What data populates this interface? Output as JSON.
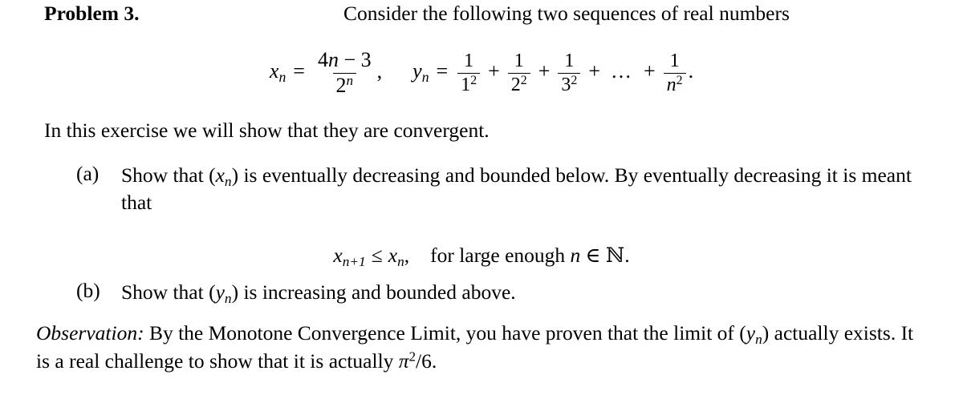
{
  "document": {
    "kind": "math-problem-statement",
    "background_color": "#ffffff",
    "text_color": "#000000"
  },
  "header": {
    "problem_label": "Problem 3.",
    "intro_sentence": "Consider the following two sequences of real numbers"
  },
  "display_equation": {
    "x_name": "x",
    "x_sub": "n",
    "equals": "=",
    "x_numerator_coef": "4",
    "x_numerator_var": "n",
    "x_numerator_minus": "−",
    "x_numerator_const": "3",
    "x_denominator_base": "2",
    "x_denominator_exp": "n",
    "comma": ",",
    "y_name": "y",
    "y_sub": "n",
    "term1_num": "1",
    "term1_den_base": "1",
    "term1_den_exp": "2",
    "plus1": "+",
    "term2_num": "1",
    "term2_den_base": "2",
    "term2_den_exp": "2",
    "plus2": "+",
    "term3_num": "1",
    "term3_den_base": "3",
    "term3_den_exp": "2",
    "plus3": "+",
    "ellipsis": "…",
    "plus4": "+",
    "termn_num": "1",
    "termn_den_base": "n",
    "termn_den_exp": "2",
    "period": "."
  },
  "body": {
    "convergent_line": "In this exercise we will show that they are convergent.",
    "items": [
      {
        "marker": "(a)",
        "text_before_var": "Show that (",
        "var": "x",
        "var_sub": "n",
        "text_after_var": ") is eventually decreasing and bounded below.  By eventually decreasing it is meant that"
      },
      {
        "marker": "(b)",
        "text_before_var": "Show that (",
        "var": "y",
        "var_sub": "n",
        "text_after_var": ") is increasing and bounded above."
      }
    ]
  },
  "center_equation": {
    "lhs_var": "x",
    "lhs_sub": "n+1",
    "relation": "≤",
    "rhs_var": "x",
    "rhs_sub": "n",
    "comma": ",",
    "condition_text_1": "for large enough ",
    "condition_var": "n",
    "condition_member": " ∈ ",
    "condition_set": "ℕ",
    "condition_period": "."
  },
  "observation": {
    "label": "Observation:",
    "text_part_1": " By the Monotone Convergence Limit, you have proven that the limit of (",
    "var": "y",
    "var_sub": "n",
    "text_part_2": ") actually exists. It is a real challenge to show that it is actually ",
    "pi": "π",
    "pi_exp": "2",
    "slash_six": "/6",
    "final_period": "."
  }
}
